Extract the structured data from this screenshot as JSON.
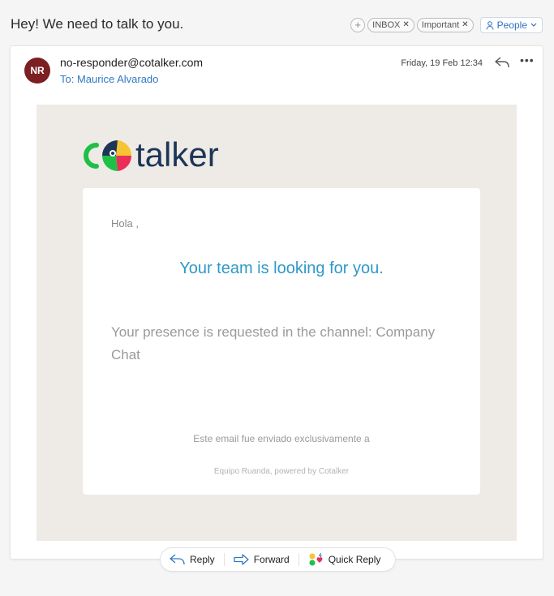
{
  "email": {
    "subject": "Hey! We need to talk to you.",
    "tags": [
      {
        "label": "INBOX"
      },
      {
        "label": "Important"
      }
    ],
    "people_label": "People",
    "sender_initials": "NR",
    "from": "no-responder@cotalker.com",
    "to": "To: Maurice Alvarado",
    "date": "Friday, 19 Feb 12:34"
  },
  "body": {
    "logo_text": "talker",
    "greeting": "Hola ,",
    "headline": "Your team is looking for you.",
    "presence": "Your presence is requested in the channel: Company Chat",
    "exclusive": "Este email fue enviado exclusivamente a",
    "powered": "Equipo Ruanda, powered by Cotalker"
  },
  "actions": {
    "reply": "Reply",
    "forward": "Forward",
    "quick_reply": "Quick Reply"
  },
  "colors": {
    "accent": "#2f78c4",
    "avatar": "#7b1f22",
    "headline": "#2e99c7",
    "email_bg": "#eeebe6",
    "logo_green": "#1fbf48",
    "logo_yellow": "#f6c332",
    "logo_red": "#ea2e58",
    "logo_navy": "#1d3557"
  }
}
